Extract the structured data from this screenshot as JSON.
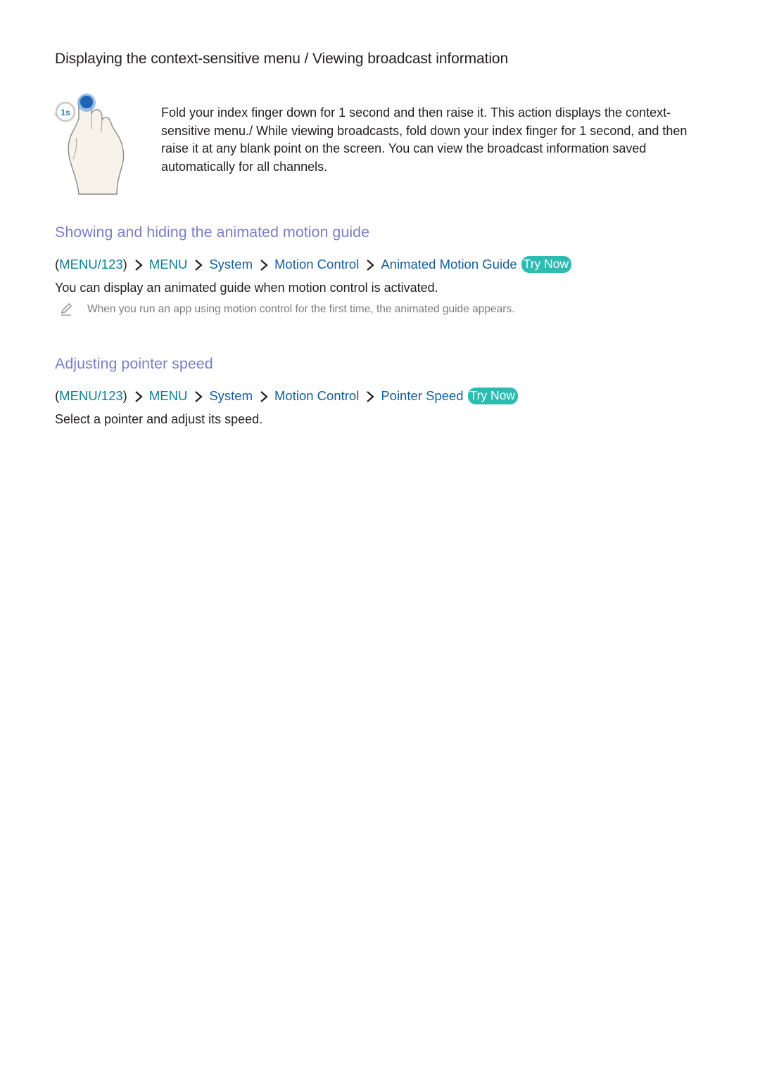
{
  "section_main": {
    "title": "Displaying the context-sensitive menu / Viewing broadcast information",
    "gesture_icon": "hand-index-finger-fold-icon",
    "gesture_badge": "1s",
    "description": "Fold your index finger down for 1 second and then raise it. This action displays the context-sensitive menu./ While viewing broadcasts, fold down your index finger for 1 second, and then raise it at any blank point on the screen. You can view the broadcast information saved automatically for all channels."
  },
  "section_guide": {
    "title": "Showing and hiding the animated motion guide",
    "path": {
      "open_paren": "(",
      "root": "MENU/123",
      "close_paren": ")",
      "items": [
        "MENU",
        "System",
        "Motion Control",
        "Animated Motion Guide"
      ],
      "separator_icon": "chevron-right-icon",
      "try_now": "Try Now"
    },
    "body": "You can display an animated guide when motion control is activated.",
    "note_icon": "pencil-note-icon",
    "note": "When you run an app using motion control for the first time, the animated guide appears."
  },
  "section_pointer": {
    "title": "Adjusting pointer speed",
    "path": {
      "open_paren": "(",
      "root": "MENU/123",
      "close_paren": ")",
      "items": [
        "MENU",
        "System",
        "Motion Control",
        "Pointer Speed"
      ],
      "separator_icon": "chevron-right-icon",
      "try_now": "Try Now"
    },
    "body": "Select a pointer and adjust its speed."
  },
  "colors": {
    "heading_sub": "#7b7fc4",
    "path_root": "#0a7f96",
    "path_item": "#135e9c",
    "try_now_bg": "#2dbbb2",
    "note_text": "#7c7c7c",
    "body_text": "#231f20"
  }
}
